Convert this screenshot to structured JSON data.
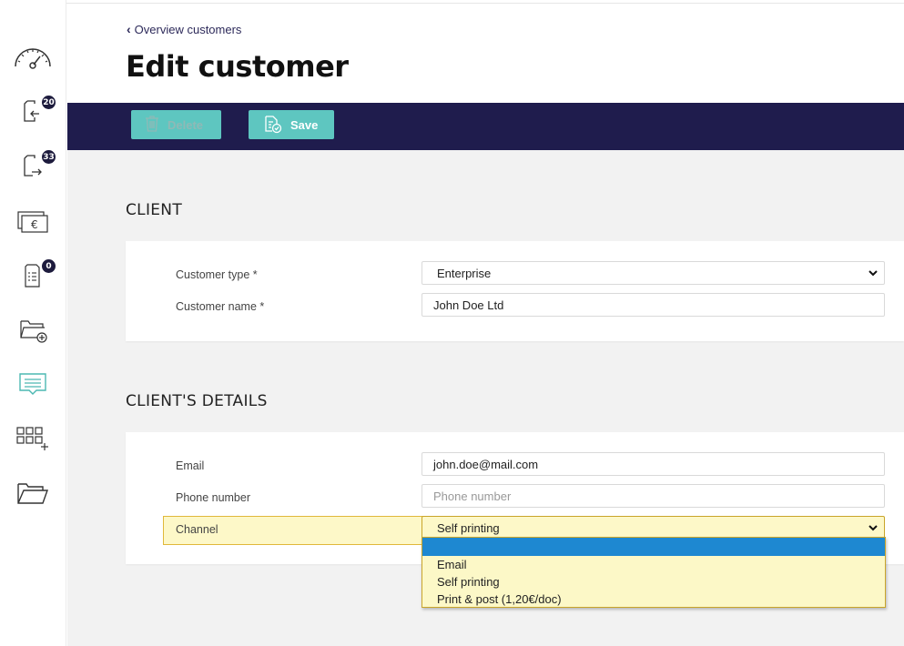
{
  "nav": {
    "back_label": "Overview customers",
    "items": [
      {
        "icon": "dashboard-icon"
      },
      {
        "icon": "incoming-documents-icon",
        "badge": "20"
      },
      {
        "icon": "outgoing-documents-icon",
        "badge": "33"
      },
      {
        "icon": "payments-icon"
      },
      {
        "icon": "checklist-icon",
        "badge": "0"
      },
      {
        "icon": "add-folder-icon"
      },
      {
        "icon": "messages-icon"
      },
      {
        "icon": "apps-grid-icon"
      },
      {
        "icon": "open-folder-icon"
      }
    ]
  },
  "page": {
    "title": "Edit customer"
  },
  "toolbar": {
    "delete_label": "Delete",
    "save_label": "Save"
  },
  "client": {
    "section_title": "CLIENT",
    "customer_type_label": "Customer type *",
    "customer_type_value": "Enterprise",
    "customer_name_label": "Customer name *",
    "customer_name_value": "John Doe Ltd"
  },
  "details": {
    "section_title": "CLIENT'S DETAILS",
    "email_label": "Email",
    "email_value": "john.doe@mail.com",
    "phone_label": "Phone number",
    "phone_placeholder": "Phone number",
    "channel_label": "Channel",
    "channel_value": "Self printing",
    "channel_options": [
      "",
      "Email",
      "Self printing",
      "Print & post (1,20€/doc)"
    ]
  },
  "colors": {
    "nav_dark": "#1f1c4d",
    "button_teal": "#5ec6c0",
    "highlight_yellow": "#fdf8c8",
    "dropdown_selected": "#1e88d1"
  }
}
